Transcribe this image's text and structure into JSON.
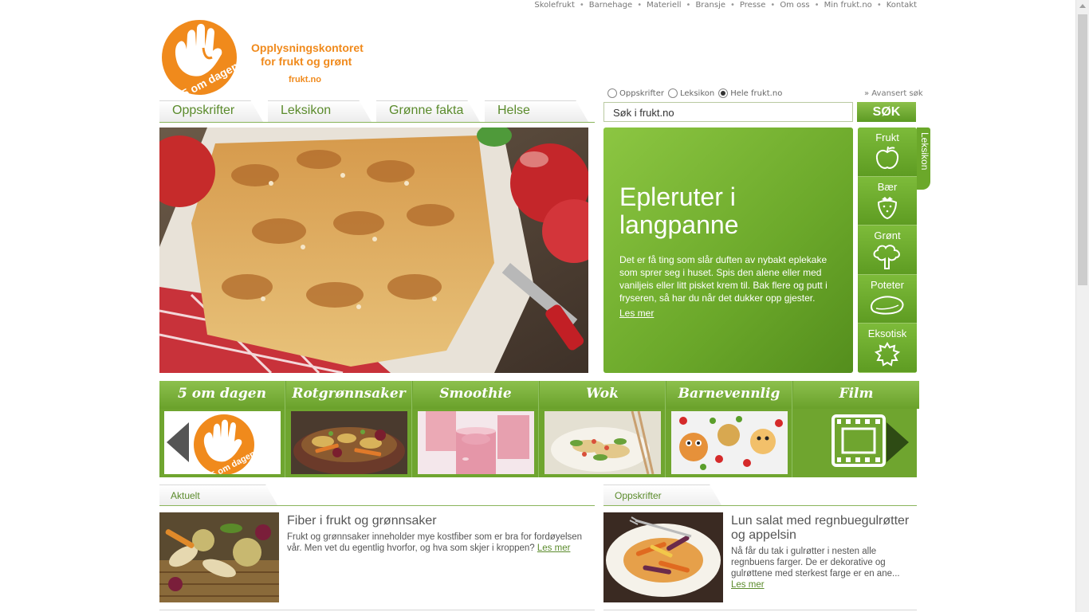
{
  "top_links": [
    "Skolefrukt",
    "Barnehage",
    "Materiell",
    "Bransje",
    "Presse",
    "Om oss",
    "Min frukt.no",
    "Kontakt"
  ],
  "logo": {
    "badge_text": "5 om dagen",
    "line1": "Opplysningskontoret",
    "line2": "for frukt og grønt",
    "url": "frukt.no"
  },
  "search": {
    "options": [
      {
        "label": "Oppskrifter",
        "selected": false
      },
      {
        "label": "Leksikon",
        "selected": false
      },
      {
        "label": "Hele frukt.no",
        "selected": true
      }
    ],
    "advanced": "» Avansert søk",
    "value": "Søk i frukt.no",
    "button": "SØK"
  },
  "tabs": [
    "Oppskrifter",
    "Leksikon",
    "Grønne fakta",
    "Helse"
  ],
  "hero": {
    "title": "Epleruter i langpanne",
    "text": "Det er få ting som slår duften av nybakt eplekake som sprer seg i huset. Spis den alene eller med vaniljeis eller litt pisket krem til. Bak flere og putt i fryseren, så har du når det dukker opp gjester.",
    "more": "Les mer"
  },
  "categories": [
    "Frukt",
    "Bær",
    "Grønt",
    "Poteter",
    "Eksotisk"
  ],
  "category_tab": "Leksikon",
  "carousel": [
    "5 om dagen",
    "Rotgrønnsaker",
    "Smoothie",
    "Wok",
    "Barnevennlig",
    "Film"
  ],
  "sections": {
    "left": {
      "header": "Aktuelt",
      "title": "Fiber i frukt og grønnsaker",
      "text": "Frukt og grønnsaker inneholder mye kostfiber som er bra for fordøyelsen vår. Men vet du egentlig hvorfor, og hva som skjer i kroppen?",
      "more": "Les mer"
    },
    "right": {
      "header": "Oppskrifter",
      "title": "Lun salat med regnbuegulrøtter og appelsin",
      "text": "Nå får du tak i gulrøtter i nesten alle regnbuens farger. De er dekorative og gulrøttene med sterkest farge er en ane...",
      "more": "Les mer"
    }
  },
  "colors": {
    "brand_green": "#6ba82a",
    "brand_orange": "#f08a1c"
  }
}
